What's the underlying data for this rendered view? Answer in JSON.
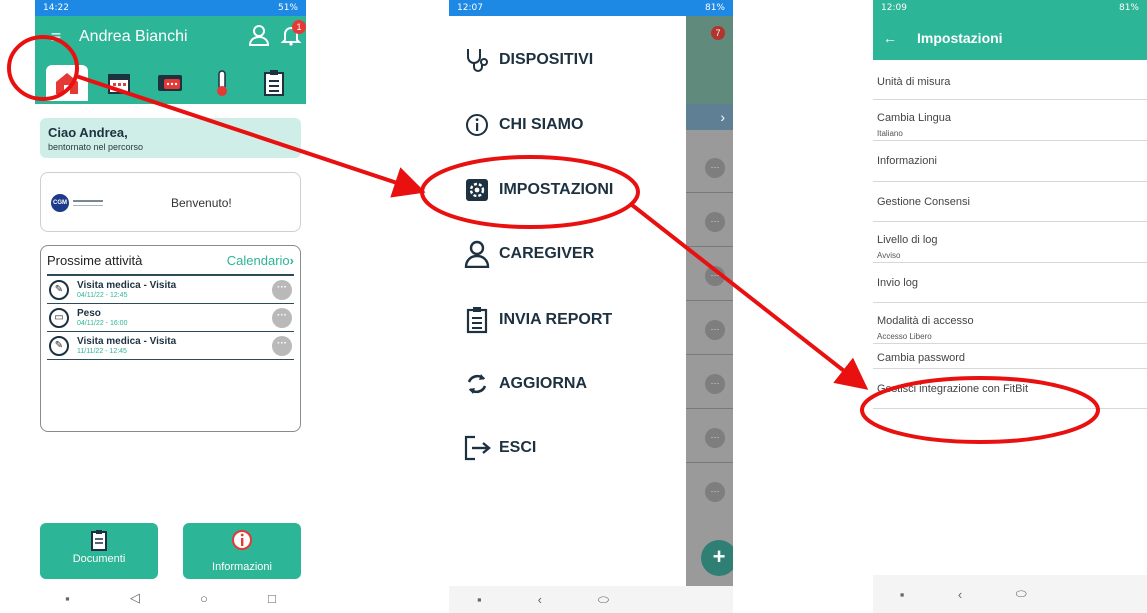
{
  "screen1": {
    "status_time": "14:22",
    "status_right": "51%",
    "user_name": "Andrea Bianchi",
    "bell_badge": "1",
    "greeting_title": "Ciao Andrea,",
    "greeting_sub": "bentornato nel percorso",
    "welcome_text": "Benvenuto!",
    "activities_title": "Prossime attività",
    "calendar_link": "Calendario",
    "activities": [
      {
        "title": "Visita medica - Visita",
        "date": "04/11/22 - 12:45",
        "icon": "stethoscope-icon"
      },
      {
        "title": "Peso",
        "date": "04/11/22 - 16:00",
        "icon": "scale-icon"
      },
      {
        "title": "Visita medica - Visita",
        "date": "11/11/22 - 12:45",
        "icon": "stethoscope-icon"
      }
    ],
    "btn_documents": "Documenti",
    "btn_info": "Informazioni"
  },
  "screen2": {
    "status_time": "12:07",
    "status_right": "81%",
    "bell_badge": "7",
    "menu": [
      {
        "label": "DISPOSITIVI",
        "icon": "stethoscope-icon"
      },
      {
        "label": "CHI SIAMO",
        "icon": "info-icon"
      },
      {
        "label": "IMPOSTAZIONI",
        "icon": "gear-icon"
      },
      {
        "label": "CAREGIVER",
        "icon": "person-icon"
      },
      {
        "label": "INVIA REPORT",
        "icon": "clipboard-icon"
      },
      {
        "label": "AGGIORNA",
        "icon": "refresh-icon"
      },
      {
        "label": "ESCI",
        "icon": "logout-icon"
      }
    ]
  },
  "screen3": {
    "status_time": "12:09",
    "status_right": "81%",
    "title": "Impostazioni",
    "settings": [
      {
        "label": "Unità di misura",
        "sub": ""
      },
      {
        "label": "Cambia Lingua",
        "sub": "Italiano"
      },
      {
        "label": "Informazioni",
        "sub": ""
      },
      {
        "label": "Gestione Consensi",
        "sub": ""
      },
      {
        "label": "Livello di log",
        "sub": "Avviso"
      },
      {
        "label": "Invio log",
        "sub": ""
      },
      {
        "label": "Modalità di accesso",
        "sub": "Accesso Libero"
      },
      {
        "label": "Cambia password",
        "sub": ""
      },
      {
        "label": "Gestisci integrazione con FitBit",
        "sub": ""
      }
    ]
  },
  "annotations": {
    "color": "#e8110f"
  }
}
